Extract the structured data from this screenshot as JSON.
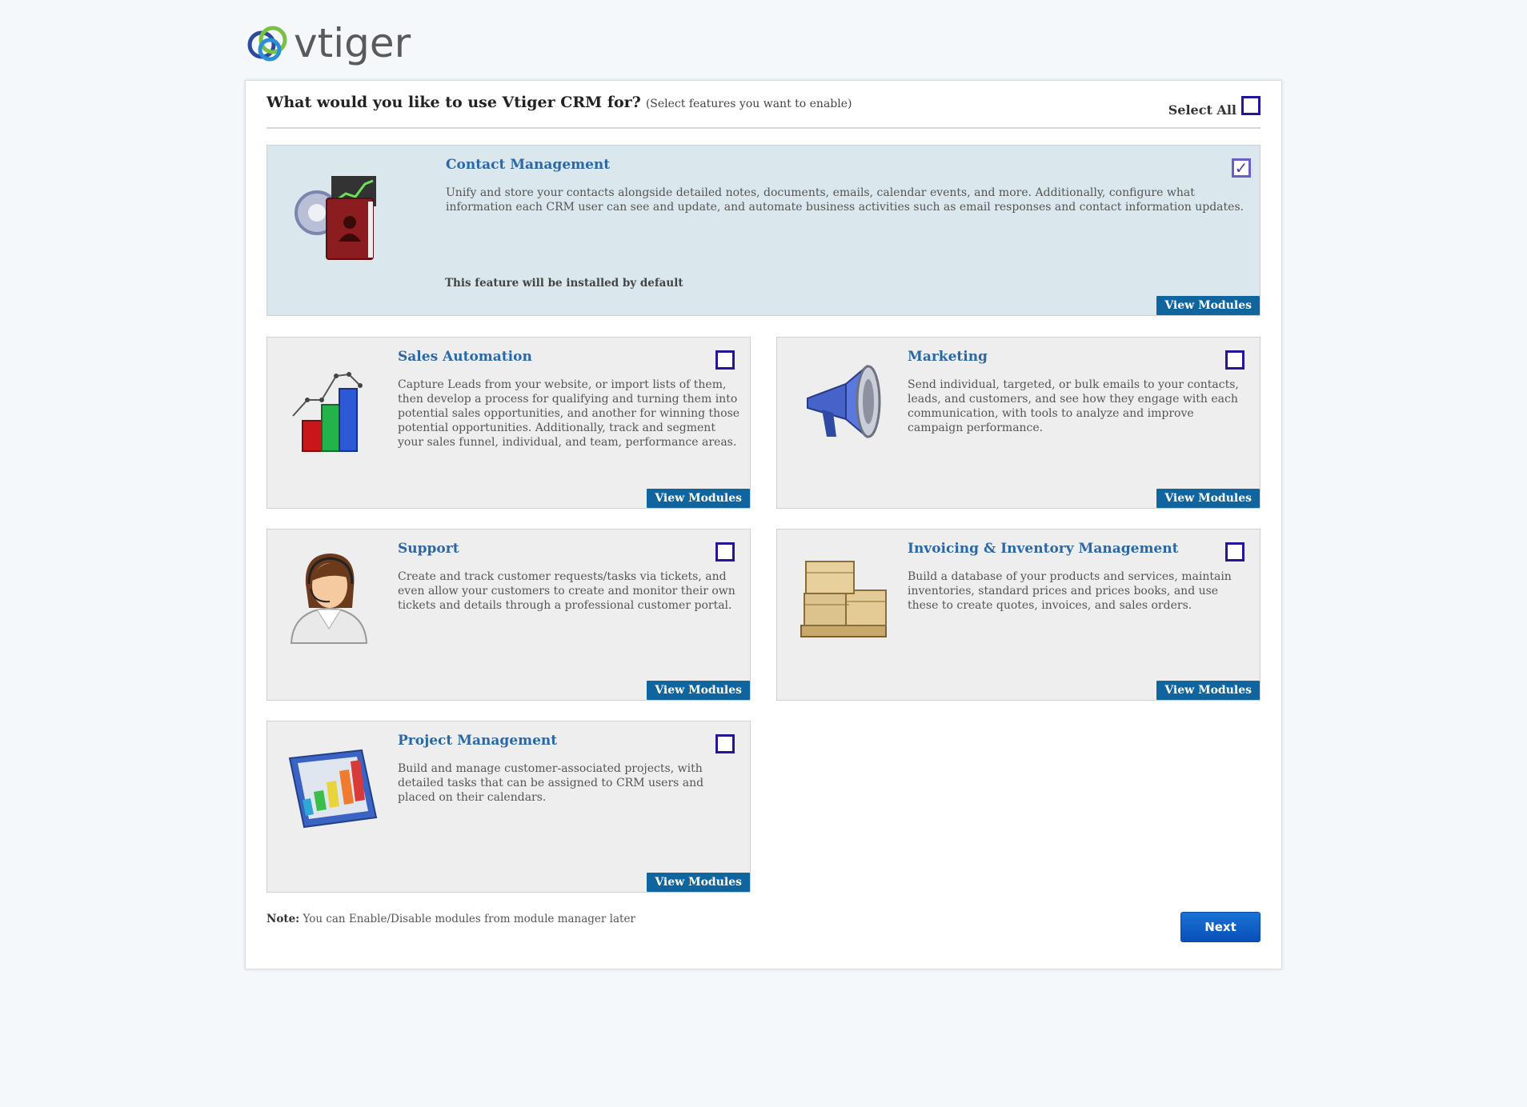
{
  "logo": {
    "text": "vtiger"
  },
  "header": {
    "question": "What would you like to use Vtiger CRM for?",
    "hint": "(Select features you want to enable)",
    "select_all_label": "Select All"
  },
  "features": {
    "contact": {
      "title": "Contact Management",
      "description": "Unify and store your contacts alongside detailed notes, documents, emails, calendar events, and more. Additionally, configure what information each CRM user can see and update, and automate business activities such as email responses and contact information updates.",
      "note": "This feature will be installed by default",
      "button": "View Modules",
      "checked": true
    },
    "sales": {
      "title": "Sales Automation",
      "description": "Capture Leads from your website, or import lists of them, then develop a process for qualifying and turning them into potential sales opportunities, and another for winning those potential opportunities. Additionally, track and segment your sales funnel, individual, and team, performance areas.",
      "button": "View Modules",
      "checked": false
    },
    "marketing": {
      "title": "Marketing",
      "description": "Send individual, targeted, or bulk emails to your contacts, leads, and customers, and see how they engage with each communication, with tools to analyze and improve campaign performance.",
      "button": "View Modules",
      "checked": false
    },
    "support": {
      "title": "Support",
      "description": "Create and track customer requests/tasks via tickets, and even allow your customers to create and monitor their own tickets and details through a professional customer portal.",
      "button": "View Modules",
      "checked": false
    },
    "inventory": {
      "title": "Invoicing & Inventory Management",
      "description": "Build a database of your products and services, maintain inventories, standard prices and prices books, and use these to create quotes, invoices, and sales orders.",
      "button": "View Modules",
      "checked": false
    },
    "project": {
      "title": "Project Management",
      "description": "Build and manage customer-associated projects, with detailed tasks that can be assigned to CRM users and placed on their calendars.",
      "button": "View Modules",
      "checked": false
    }
  },
  "footer": {
    "note_label": "Note:",
    "note_text": "You can Enable/Disable modules from module manager later",
    "next_label": "Next"
  },
  "colors": {
    "accent": "#11659f",
    "title": "#2c67a6",
    "checkbox": "#24169a",
    "next": "#0a5fd0",
    "highlight_card": "#dae7ec"
  }
}
